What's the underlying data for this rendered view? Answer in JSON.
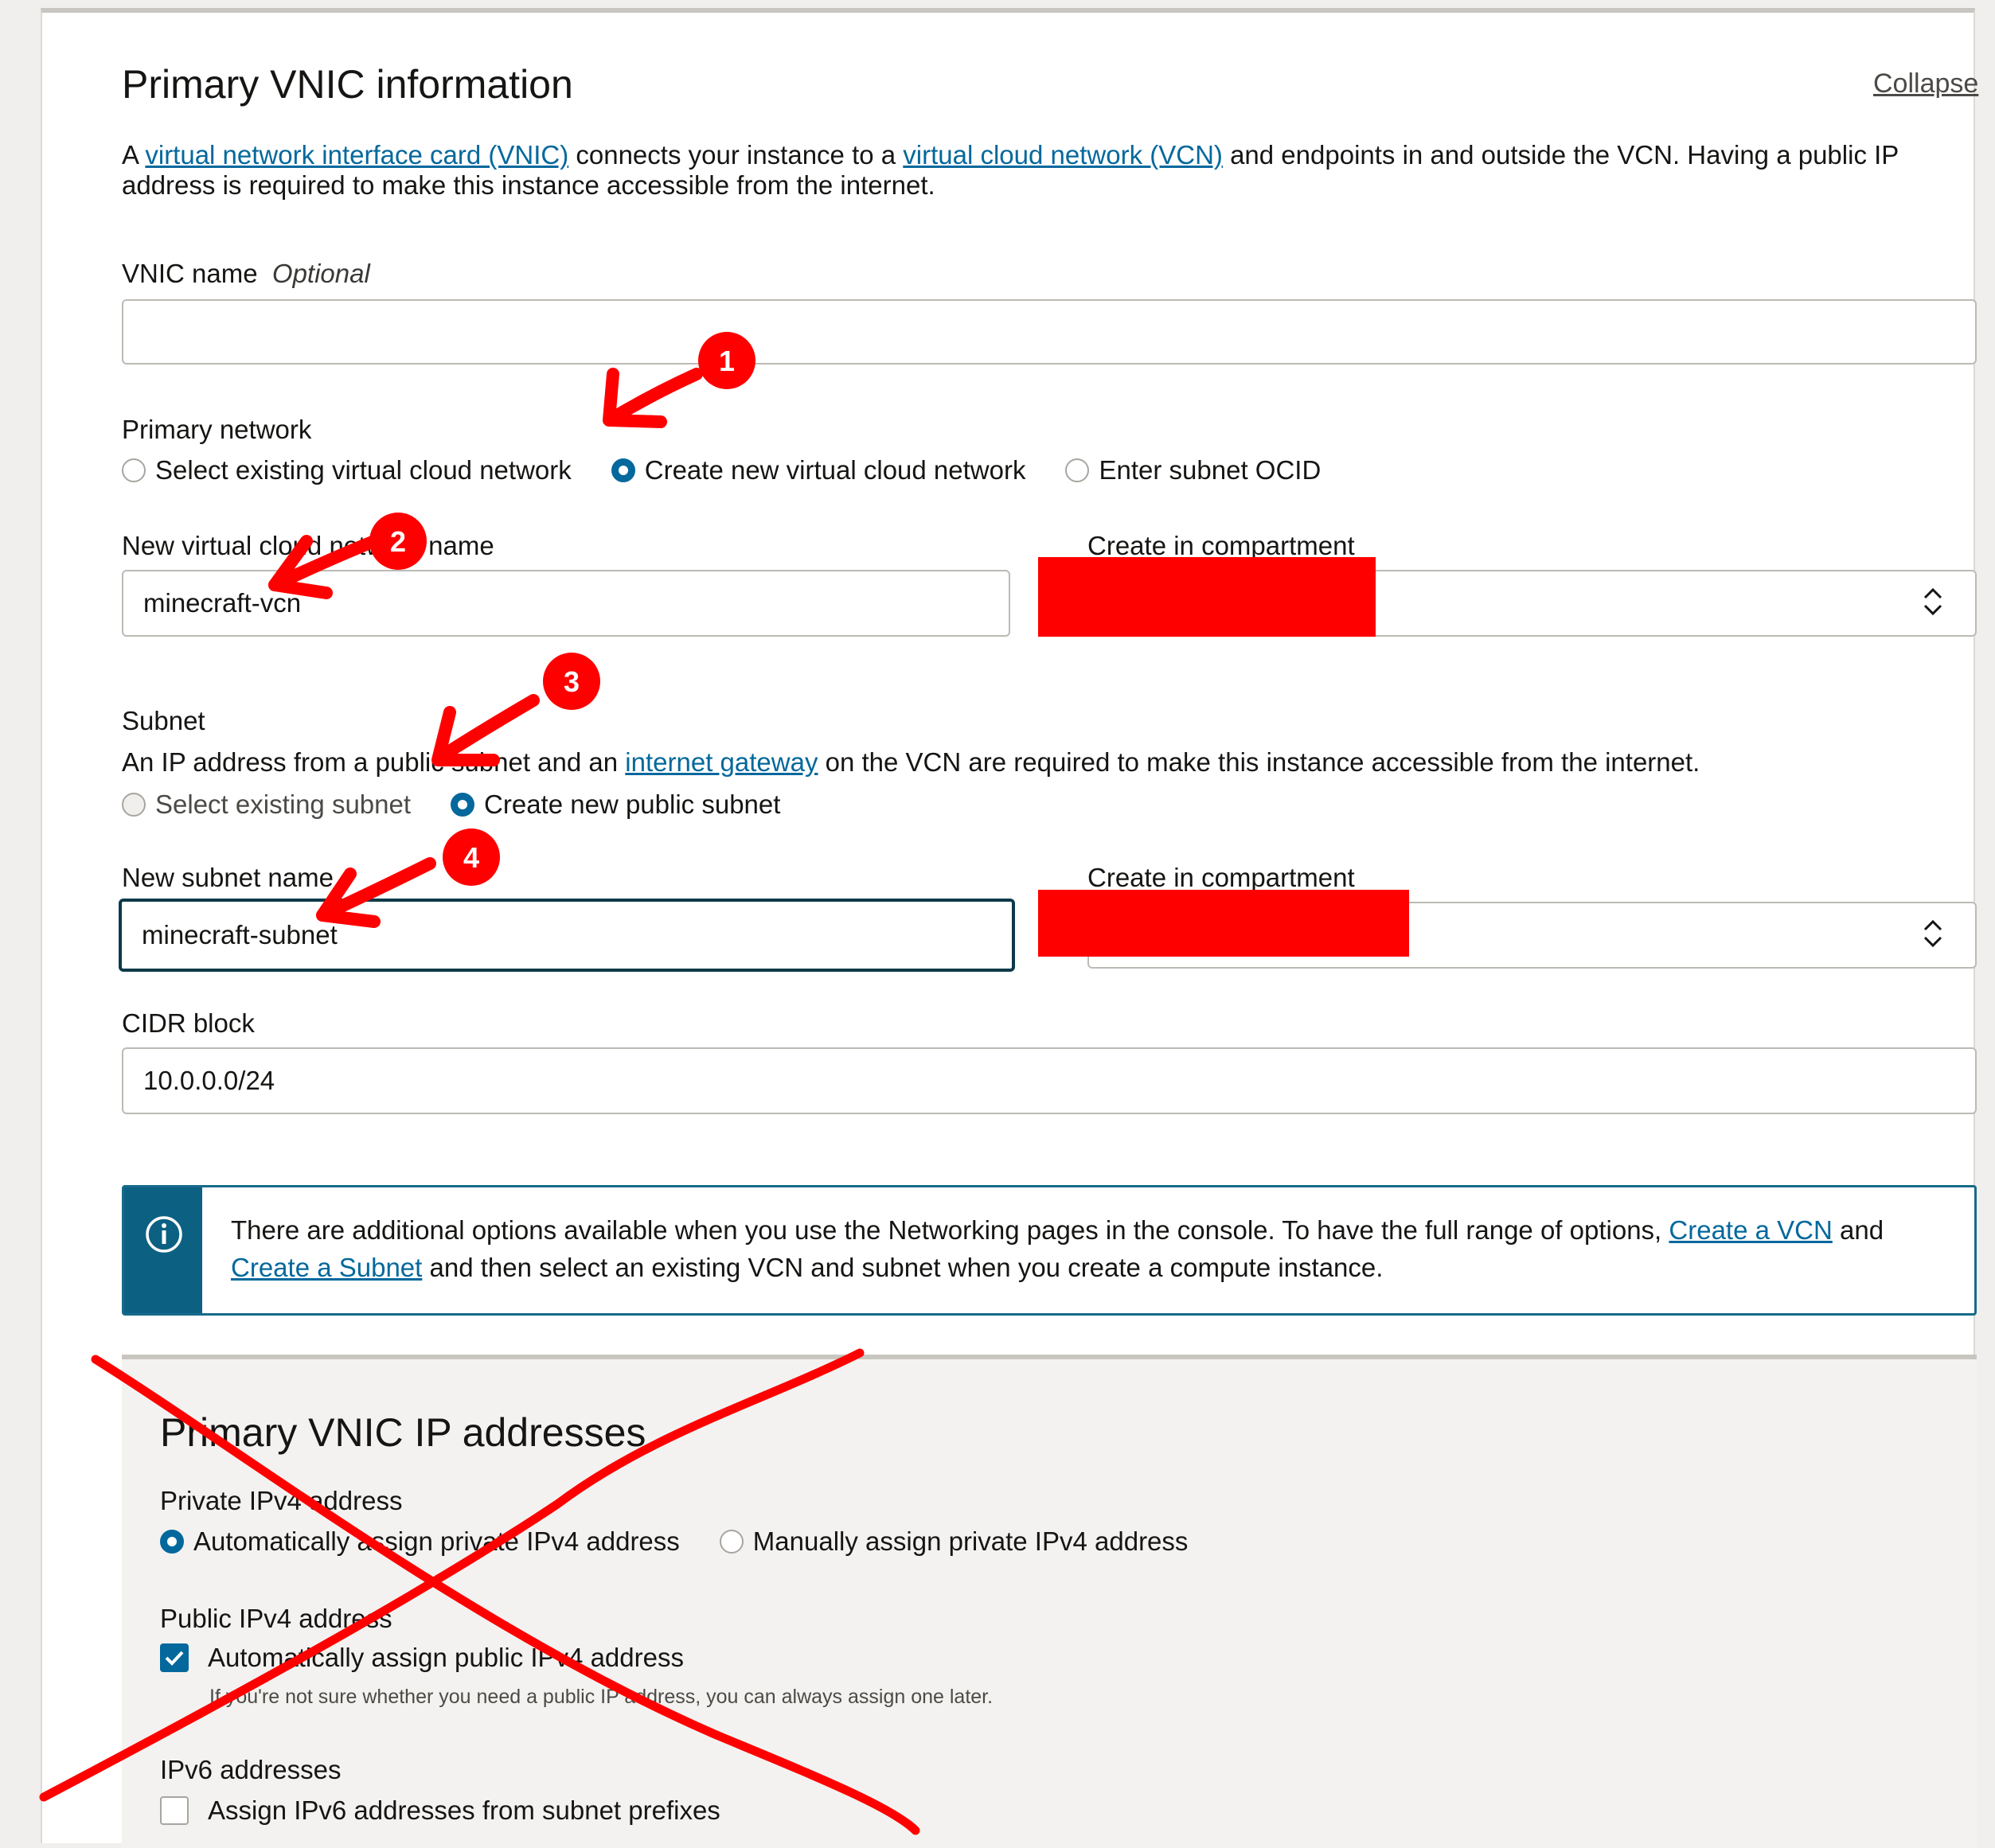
{
  "section": {
    "title": "Primary VNIC information",
    "collapse_label": "Collapse",
    "intro": {
      "t1": "A ",
      "link_vnic": "virtual network interface card (VNIC)",
      "t2": " connects your instance to a ",
      "link_vcn": "virtual cloud network (VCN)",
      "t3": " and endpoints in and outside the VCN. Having a public IP address is required to make this instance accessible from the internet."
    }
  },
  "vnic_name": {
    "label": "VNIC name",
    "optional": "Optional",
    "value": ""
  },
  "primary_network": {
    "label": "Primary network",
    "options": [
      {
        "label": "Select existing virtual cloud network",
        "selected": false
      },
      {
        "label": "Create new virtual cloud network",
        "selected": true
      },
      {
        "label": "Enter subnet OCID",
        "selected": false
      }
    ]
  },
  "new_vcn": {
    "label": "New virtual cloud network name",
    "value": "minecraft-vcn"
  },
  "vcn_compartment": {
    "label": "Create in compartment"
  },
  "subnet": {
    "label": "Subnet",
    "desc": {
      "t1": "An IP address from a public subnet and an ",
      "link_gateway": "internet gateway",
      "t2": " on the VCN are required to make this instance accessible from the internet."
    },
    "options": [
      {
        "label": "Select existing subnet",
        "selected": false
      },
      {
        "label": "Create new public subnet",
        "selected": true
      }
    ]
  },
  "new_subnet": {
    "label": "New subnet name",
    "value": "minecraft-subnet"
  },
  "subnet_compartment": {
    "label": "Create in compartment"
  },
  "cidr": {
    "label": "CIDR block",
    "value": "10.0.0.0/24"
  },
  "info_box": {
    "t1": "There are additional options available when you use the Networking pages in the console. To have the full range of options, ",
    "link_create_vcn": "Create a VCN",
    "t2": " and ",
    "link_create_subnet": "Create a Subnet",
    "t3": " and then select an existing VCN and subnet when you create a compute instance."
  },
  "ip_section": {
    "title": "Primary VNIC IP addresses",
    "private_ipv4": {
      "label": "Private IPv4 address",
      "options": [
        {
          "label": "Automatically assign private IPv4 address",
          "selected": true
        },
        {
          "label": "Manually assign private IPv4 address",
          "selected": false
        }
      ]
    },
    "public_ipv4": {
      "label": "Public IPv4 address",
      "checkbox_label": "Automatically assign public IPv4 address",
      "checked": true,
      "hint": "If you're not sure whether you need a public IP address, you can always assign one later."
    },
    "ipv6": {
      "label": "IPv6 addresses",
      "checkbox_label": "Assign IPv6 addresses from subnet prefixes",
      "checked": false
    }
  },
  "annotations": {
    "step1": "1",
    "step2": "2",
    "step3": "3",
    "step4": "4"
  },
  "colors": {
    "accent": "#04689c",
    "annotation_red": "#ff0000",
    "info_bar": "#0c6183"
  },
  "icons": {
    "info": "info-circle-icon",
    "select": "chevron-up-down-icon",
    "check": "check-icon"
  }
}
